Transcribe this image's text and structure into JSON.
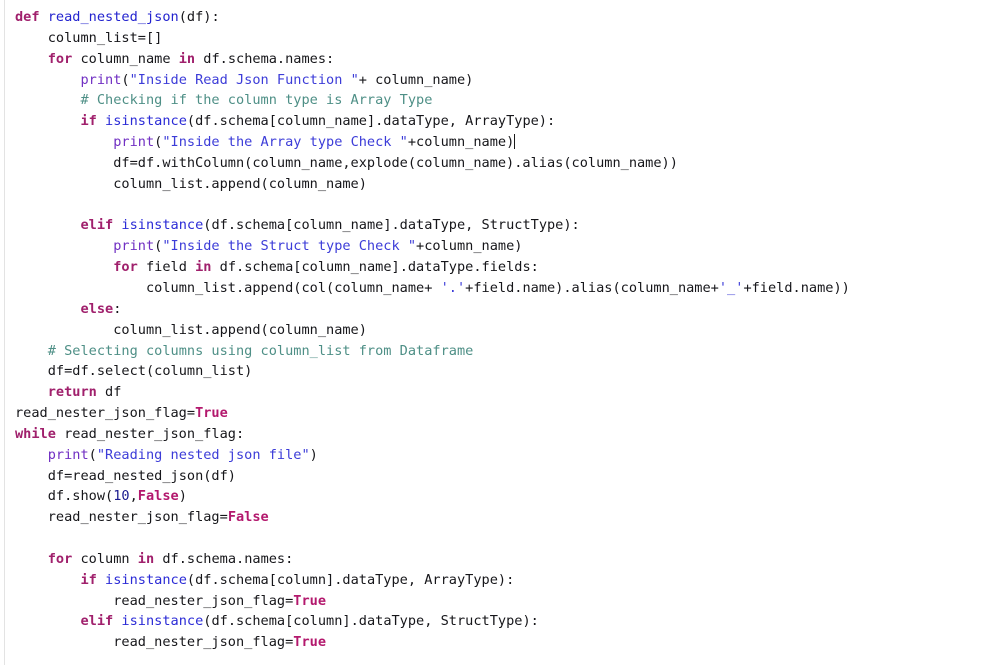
{
  "editor": {
    "language": "python",
    "background_color": "#ffffff",
    "gutter_rule_color": "#e3e3e3",
    "caret_color": "#1a1a1a",
    "syntax_colors": {
      "keyword": "#a0206c",
      "constant": "#b3186d",
      "builtin": "#7130c3",
      "function": "#2b2bd6",
      "string": "#3c3cd8",
      "comment": "#4e8f86",
      "number": "#1b1b8f",
      "plain": "#16161a"
    }
  },
  "code": {
    "lines": [
      "def read_nested_json(df):",
      "    column_list=[]",
      "    for column_name in df.schema.names:",
      "        print(\"Inside Read Json Function \"+ column_name)",
      "        # Checking if the column type is Array Type",
      "        if isinstance(df.schema[column_name].dataType, ArrayType):",
      "            print(\"Inside the Array type Check \"+column_name)",
      "            df=df.withColumn(column_name,explode(column_name).alias(column_name))",
      "            column_list.append(column_name)",
      "",
      "        elif isinstance(df.schema[column_name].dataType, StructType):",
      "            print(\"Inside the Struct type Check \"+column_name)",
      "            for field in df.schema[column_name].dataType.fields:",
      "                column_list.append(col(column_name+ '.'+field.name).alias(column_name+'_'+field.name))",
      "        else:",
      "            column_list.append(column_name)",
      "    # Selecting columns using column_list from Dataframe",
      "    df=df.select(column_list)",
      "    return df",
      "read_nester_json_flag=True",
      "while read_nester_json_flag:",
      "    print(\"Reading nested json file\")",
      "    df=read_nested_json(df)",
      "    df.show(10,False)",
      "    read_nester_json_flag=False",
      "",
      "    for column in df.schema.names:",
      "        if isinstance(df.schema[column].dataType, ArrayType):",
      "            read_nester_json_flag=True",
      "        elif isinstance(df.schema[column].dataType, StructType):",
      "            read_nester_json_flag=True"
    ],
    "caret_line_index": 6,
    "caret_after_text": "column_name)"
  },
  "tokens": {
    "line_0": {
      "kw_def": "def",
      "name": "read_nested_json",
      "tail": "(df):"
    },
    "line_1": {
      "text": "    column_list=[]"
    },
    "line_2": {
      "kw_for": "for",
      "var": " column_name ",
      "kw_in": "in",
      "tail": " df.schema.names:"
    },
    "line_3": {
      "builtin": "print",
      "open": "(",
      "str": "\"Inside Read Json Function \"",
      "tail": "+ column_name)"
    },
    "line_4": {
      "comment": "# Checking if the column type is Array Type"
    },
    "line_5": {
      "kw_if": "if",
      "func": " isinstance",
      "tail": "(df.schema[column_name].dataType, ArrayType):"
    },
    "line_6": {
      "builtin": "print",
      "open": "(",
      "str": "\"Inside the Array type Check \"",
      "tail": "+column_name)"
    },
    "line_7": {
      "text": "df=df.withColumn(column_name,explode(column_name).alias(column_name))"
    },
    "line_8": {
      "text": "column_list.append(column_name)"
    },
    "line_10": {
      "kw_elif": "elif",
      "func": " isinstance",
      "tail": "(df.schema[column_name].dataType, StructType):"
    },
    "line_11": {
      "builtin": "print",
      "open": "(",
      "str": "\"Inside the Struct type Check \"",
      "tail": "+column_name)"
    },
    "line_12": {
      "kw_for": "for",
      "var": " field ",
      "kw_in": "in",
      "tail": " df.schema[column_name].dataType.fields:"
    },
    "line_13": {
      "pre": "column_list.append(col(column_name+ ",
      "str1": "'.'",
      "mid": "+field.name).alias(column_name+",
      "str2": "'_'",
      "post": "+field.name))"
    },
    "line_14": {
      "kw_else": "else",
      "tail": ":"
    },
    "line_15": {
      "text": "column_list.append(column_name)"
    },
    "line_16": {
      "comment": "# Selecting columns using column_list from Dataframe"
    },
    "line_17": {
      "text": "df=df.select(column_list)"
    },
    "line_18": {
      "kw_return": "return",
      "tail": " df"
    },
    "line_19": {
      "pre": "read_nester_json_flag=",
      "const": "True"
    },
    "line_20": {
      "kw_while": "while",
      "tail": " read_nester_json_flag:"
    },
    "line_21": {
      "builtin": "print",
      "open": "(",
      "str": "\"Reading nested json file\"",
      "tail": ")"
    },
    "line_22": {
      "text": "df=read_nested_json(df)"
    },
    "line_23": {
      "pre": "df.show(",
      "num": "10",
      "mid": ",",
      "const": "False",
      "post": ")"
    },
    "line_24": {
      "pre": "read_nester_json_flag=",
      "const": "False"
    },
    "line_26": {
      "kw_for": "for",
      "var": " column ",
      "kw_in": "in",
      "tail": " df.schema.names:"
    },
    "line_27": {
      "kw_if": "if",
      "func": " isinstance",
      "tail": "(df.schema[column].dataType, ArrayType):"
    },
    "line_28": {
      "pre": "read_nester_json_flag=",
      "const": "True"
    },
    "line_29": {
      "kw_elif": "elif",
      "func": " isinstance",
      "tail": "(df.schema[column].dataType, StructType):"
    },
    "line_30": {
      "pre": "read_nester_json_flag=",
      "const": "True"
    }
  }
}
